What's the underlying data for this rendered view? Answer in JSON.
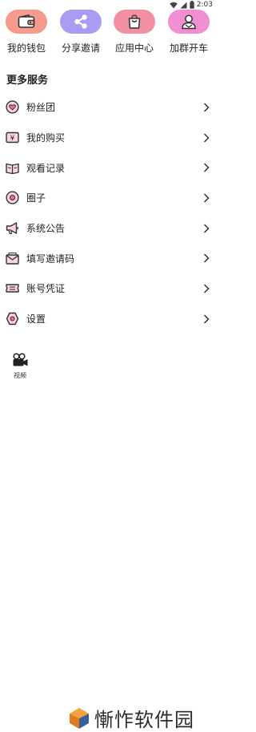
{
  "status_bar": {
    "time": "2:03"
  },
  "quick_actions": [
    {
      "label": "我的钱包",
      "icon": "wallet-icon",
      "color": "#f59a8c"
    },
    {
      "label": "分享邀请",
      "icon": "share-icon",
      "color": "#a99cf2"
    },
    {
      "label": "应用中心",
      "icon": "shopping-bag-icon",
      "color": "#f28fa0"
    },
    {
      "label": "加群开车",
      "icon": "user-group-icon",
      "color": "#f18fd3"
    }
  ],
  "section_title": "更多服务",
  "menu": [
    {
      "label": "粉丝团",
      "icon": "heart-icon"
    },
    {
      "label": "我的购买",
      "icon": "yen-receipt-icon"
    },
    {
      "label": "观看记录",
      "icon": "book-icon"
    },
    {
      "label": "圈子",
      "icon": "circle-icon"
    },
    {
      "label": "系统公告",
      "icon": "megaphone-icon"
    },
    {
      "label": "填写邀请码",
      "icon": "envelope-icon"
    },
    {
      "label": "账号凭证",
      "icon": "ticket-icon"
    },
    {
      "label": "设置",
      "icon": "gear-icon"
    }
  ],
  "tabbar": {
    "video_label": "视频"
  },
  "watermark": {
    "text": "慚怍软件园"
  },
  "colors": {
    "icon_pink": "#f0709a",
    "icon_fill": "#fbd3dd",
    "accent_orange": "#f5a13c"
  }
}
